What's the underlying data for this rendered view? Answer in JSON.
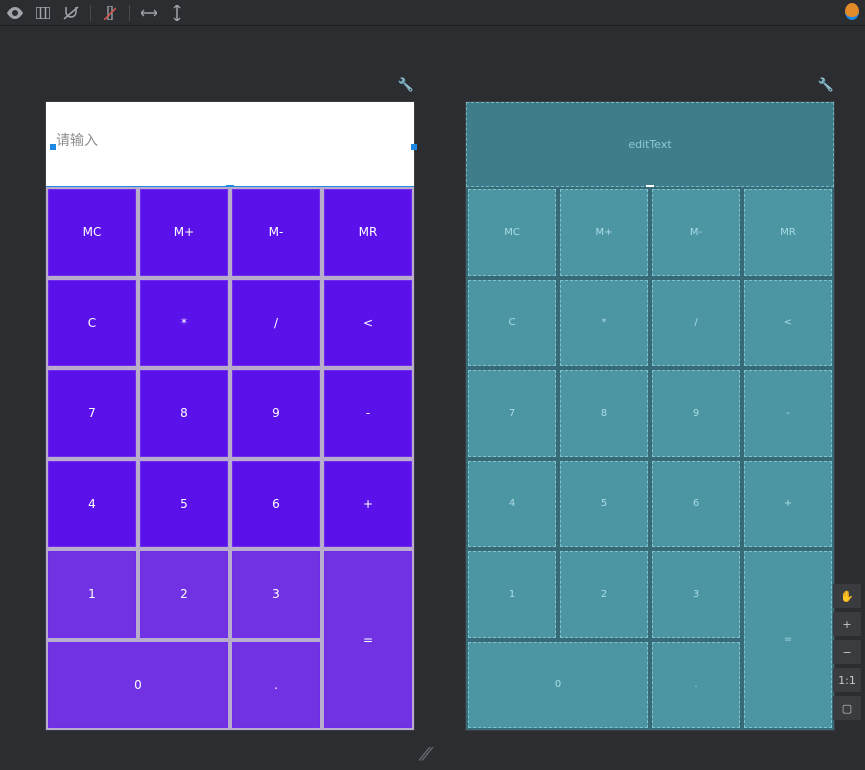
{
  "input": {
    "placeholder_design": "请输入",
    "placeholder_blueprint": "editText"
  },
  "buttons": {
    "r0c0": "MC",
    "r0c1": "M+",
    "r0c2": "M-",
    "r0c3": "MR",
    "r1c0": "C",
    "r1c1": "*",
    "r1c2": "/",
    "r1c3": "<",
    "r2c0": "7",
    "r2c1": "8",
    "r2c2": "9",
    "r2c3": "-",
    "r3c0": "4",
    "r3c1": "5",
    "r3c2": "6",
    "r3c3": "+",
    "r4c0": "1",
    "r4c1": "2",
    "r4c2": "3",
    "r4c3": "=",
    "r5c0": "0",
    "r5c2": "."
  },
  "zoom": {
    "pan": "✋",
    "plus": "+",
    "minus": "−",
    "oneone": "1:1",
    "fit": "▢"
  },
  "footer_hint": ""
}
